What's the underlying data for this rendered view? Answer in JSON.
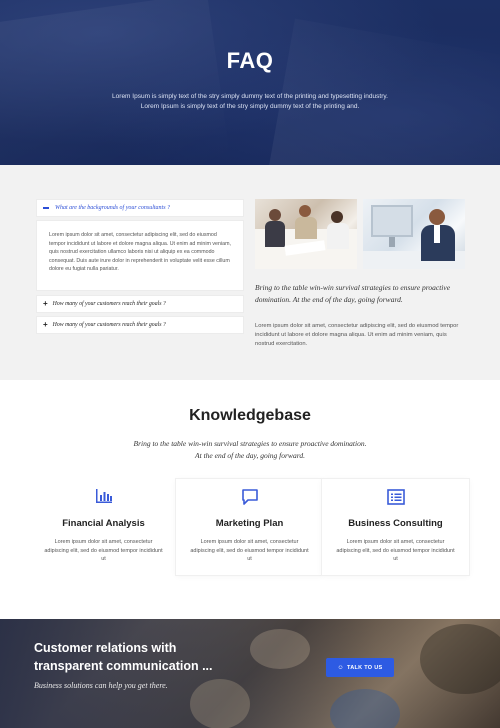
{
  "hero": {
    "title": "FAQ",
    "subtitle_line1": "Lorem Ipsum is simply text of the stry simply dummy text of the printing and typesetting industry.",
    "subtitle_line2": "Lorem Ipsum is simply text of the stry simply dummy text of the printing and."
  },
  "faq": {
    "items": [
      {
        "question": "What are the backgrounds of your consultants ?",
        "expanded": true,
        "answer": "Lorem ipsum dolor sit amet, consectetur adipiscing elit, sed do eiusmod tempor incididunt ut labore et dolore magna aliqua. Ut enim ad minim veniam, quis nostrud exercitation ullamco laboris nisi ut aliquip ex ea commodo consequat. Duis aute irure dolor in reprehenderit in voluptate velit esse cillum dolore eu fugiat nulla pariatur."
      },
      {
        "question": "How many of your customers reach their goals ?",
        "expanded": false
      },
      {
        "question": "How many of your customers reach their goals ?",
        "expanded": false
      }
    ],
    "quote": "Bring to the table win-win survival strategies to ensure proactive domination. At the end of the day, going forward.",
    "paragraph": "Lorem ipsum dolor sit amet, consectetur adipiscing elit, sed do eiusmod tempor incididunt ut labore et dolore magna aliqua. Ut enim ad minim veniam, quis nostrud exercitation."
  },
  "knowledgebase": {
    "title": "Knowledgebase",
    "subtitle_line1": "Bring to the table win-win survival strategies to ensure proactive domination.",
    "subtitle_line2": "At the end of the day, going forward.",
    "cards": [
      {
        "icon": "bar-chart-icon",
        "title": "Financial Analysis",
        "description": "Lorem ipsum dolor sit amet, consectetur adipiscing elit, sed do eiusmod tempor incididunt ut"
      },
      {
        "icon": "chat-bubble-icon",
        "title": "Marketing Plan",
        "description": "Lorem ipsum dolor sit amet, consectetur adipiscing elit, sed do eiusmod tempor incididunt ut"
      },
      {
        "icon": "list-icon",
        "title": "Business Consulting",
        "description": "Lorem ipsum dolor sit amet, consectetur adipiscing elit, sed do eiusmod tempor incididunt ut"
      }
    ]
  },
  "cta": {
    "title_line1": "Customer relations with",
    "title_line2": "transparent communication ...",
    "subtitle": "Business solutions can help you get there.",
    "button_label": "TALK TO US",
    "button_icon": "chat-icon"
  },
  "colors": {
    "accent": "#2d5be3",
    "hero_bg": "#1c2f63",
    "section_bg": "#f2f2f2",
    "icon_color": "#3a5bd9"
  }
}
